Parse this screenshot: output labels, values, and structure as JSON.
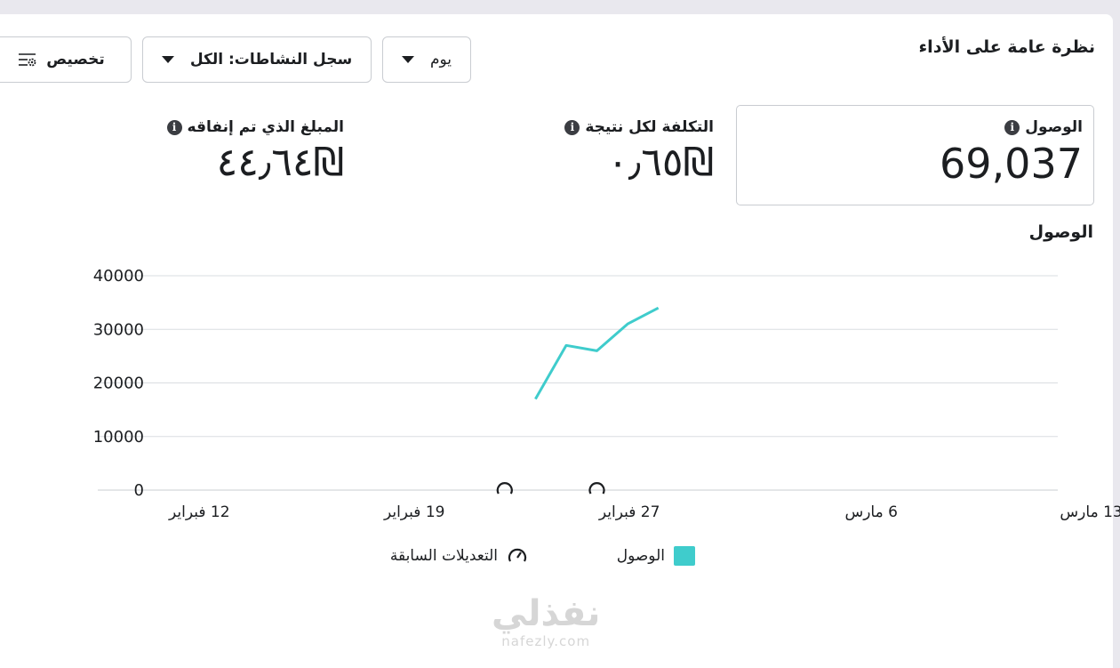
{
  "header": {
    "title": "نظرة عامة على الأداء",
    "day_label": "يوم",
    "log_label": "سجل النشاطات: الكل",
    "customize_label": "تخصيص"
  },
  "metrics": {
    "reach": {
      "label": "الوصول",
      "value": "69,037"
    },
    "cost_per_result": {
      "label": "التكلفة لكل نتيجة",
      "value": "٠٫٦٥₪"
    },
    "amount_spent": {
      "label": "المبلغ الذي تم إنفاقه",
      "value": "٤٤٫٦٤₪"
    }
  },
  "chart_section_title": "الوصول",
  "chart_data": {
    "type": "line",
    "ylim": [
      0,
      40000
    ],
    "y_ticks": [
      "40000",
      "30000",
      "20000",
      "10000",
      "0"
    ],
    "x_ticks": [
      "12 فبراير",
      "19 فبراير",
      "27 فبراير",
      "6 مارس",
      "13 مارس"
    ],
    "series": [
      {
        "name": "الوصول",
        "color": "#3fcccc",
        "points": [
          {
            "x": "2024-02-25",
            "y": 17000
          },
          {
            "x": "2024-02-26",
            "y": 27000
          },
          {
            "x": "2024-02-27",
            "y": 26000
          },
          {
            "x": "2024-02-28",
            "y": 31000
          },
          {
            "x": "2024-02-29",
            "y": 34000
          }
        ]
      }
    ],
    "edit_markers": [
      "2024-02-24",
      "2024-02-27"
    ],
    "grid": true,
    "legend_position": "bottom"
  },
  "legend": {
    "reach_label": "الوصول",
    "edits_label": "التعديلات السابقة"
  },
  "watermark": {
    "arabic": "نفذلي",
    "latin": "nafezly.com"
  }
}
